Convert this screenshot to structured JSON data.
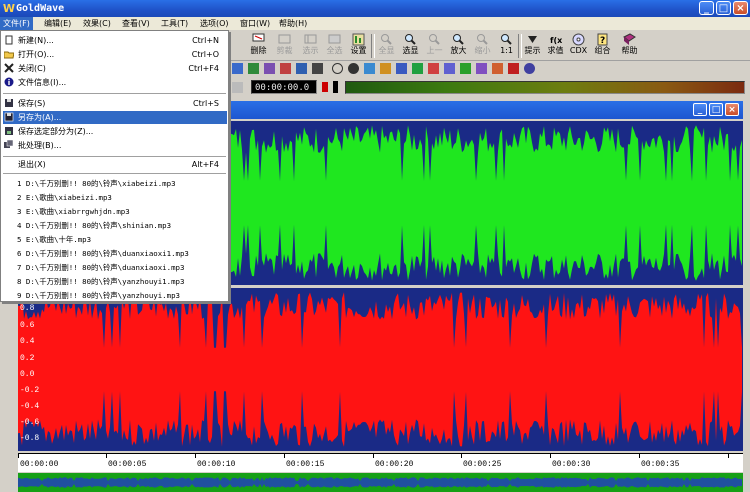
{
  "window": {
    "title": "GoldWave"
  },
  "menubar": [
    {
      "label": "文件(F)",
      "active": true
    },
    {
      "label": "编辑(E)"
    },
    {
      "label": "效果(C)"
    },
    {
      "label": "查看(V)"
    },
    {
      "label": "工具(T)"
    },
    {
      "label": "选项(O)"
    },
    {
      "label": "窗口(W)"
    },
    {
      "label": "帮助(H)"
    }
  ],
  "toolbar": {
    "buttons": [
      {
        "label": "删除",
        "icon": "scissors-delete-icon",
        "enabled": true
      },
      {
        "label": "剪裁",
        "icon": "trim-icon",
        "enabled": false
      },
      {
        "label": "选示",
        "icon": "select-view-icon",
        "enabled": false
      },
      {
        "label": "全选",
        "icon": "select-all-icon",
        "enabled": false
      },
      {
        "label": "设置",
        "icon": "settings-icon",
        "enabled": true
      },
      {
        "label": "全显",
        "icon": "show-all-icon",
        "enabled": false
      },
      {
        "label": "选显",
        "icon": "show-selection-icon",
        "enabled": true
      },
      {
        "label": "上一",
        "icon": "previous-icon",
        "enabled": false
      },
      {
        "label": "放大",
        "icon": "zoom-in-icon",
        "enabled": true
      },
      {
        "label": "缩小",
        "icon": "zoom-out-icon",
        "enabled": false
      },
      {
        "label": "1:1",
        "icon": "zoom-1to1-icon",
        "enabled": true
      },
      {
        "label": "提示",
        "icon": "cue-icon",
        "enabled": true
      },
      {
        "label": "求值",
        "icon": "evaluate-icon",
        "enabled": true
      },
      {
        "label": "CDX",
        "icon": "cd-extract-icon",
        "enabled": true
      },
      {
        "label": "组合",
        "icon": "combine-icon",
        "enabled": true
      },
      {
        "label": "帮助",
        "icon": "help-book-icon",
        "enabled": true
      }
    ]
  },
  "transport": {
    "time": "00:00:00.0"
  },
  "file_menu": {
    "items": [
      {
        "label": "新建(N)...",
        "shortcut": "Ctrl+N",
        "icon": "new-file-icon"
      },
      {
        "label": "打开(O)...",
        "shortcut": "Ctrl+O",
        "icon": "open-folder-icon"
      },
      {
        "label": "关闭(C)",
        "shortcut": "Ctrl+F4",
        "icon": "close-x-icon"
      },
      {
        "label": "文件信息(I)...",
        "shortcut": "",
        "icon": "info-icon"
      }
    ],
    "save_items": [
      {
        "label": "保存(S)",
        "shortcut": "Ctrl+S",
        "icon": "save-disk-icon",
        "selected": false
      },
      {
        "label": "另存为(A)...",
        "shortcut": "",
        "icon": "save-as-icon",
        "selected": true
      },
      {
        "label": "保存选定部分为(Z)...",
        "shortcut": "",
        "icon": "save-selection-icon",
        "selected": false
      },
      {
        "label": "批处理(B)...",
        "shortcut": "",
        "icon": "batch-icon",
        "selected": false
      }
    ],
    "exit": {
      "label": "退出(X)",
      "shortcut": "Alt+F4"
    },
    "recent": [
      "1 D:\\千万别删!! 80的\\铃声\\xiabeizi.mp3",
      "2 E:\\歌曲\\xiabeizi.mp3",
      "3 E:\\歌曲\\xiabrrgwhjdn.mp3",
      "4 D:\\千万别删!! 80的\\铃声\\shinian.mp3",
      "5 E:\\歌曲\\十年.mp3",
      "6 D:\\千万别删!! 80的\\铃声\\duanxiaoxi1.mp3",
      "7 D:\\千万别删!! 80的\\铃声\\duanxiaoxi.mp3",
      "8 D:\\千万别删!! 80的\\铃声\\yanzhouyi1.mp3",
      "9 D:\\千万别删!! 80的\\铃声\\yanzhouyi.mp3"
    ]
  },
  "waveform": {
    "left_color": "#1fe71f",
    "right_color": "#ff1313",
    "background_color": "#1a2a86",
    "right_ylabels": [
      "0.8",
      "0.6",
      "0.4",
      "0.2",
      "0.0",
      "-0.2",
      "-0.4",
      "-0.6",
      "-0.8"
    ]
  },
  "timeline": {
    "labels": [
      "00:00:00",
      "00:00:05",
      "00:00:10",
      "00:00:15",
      "00:00:20",
      "00:00:25",
      "00:00:30",
      "00:00:35"
    ]
  }
}
